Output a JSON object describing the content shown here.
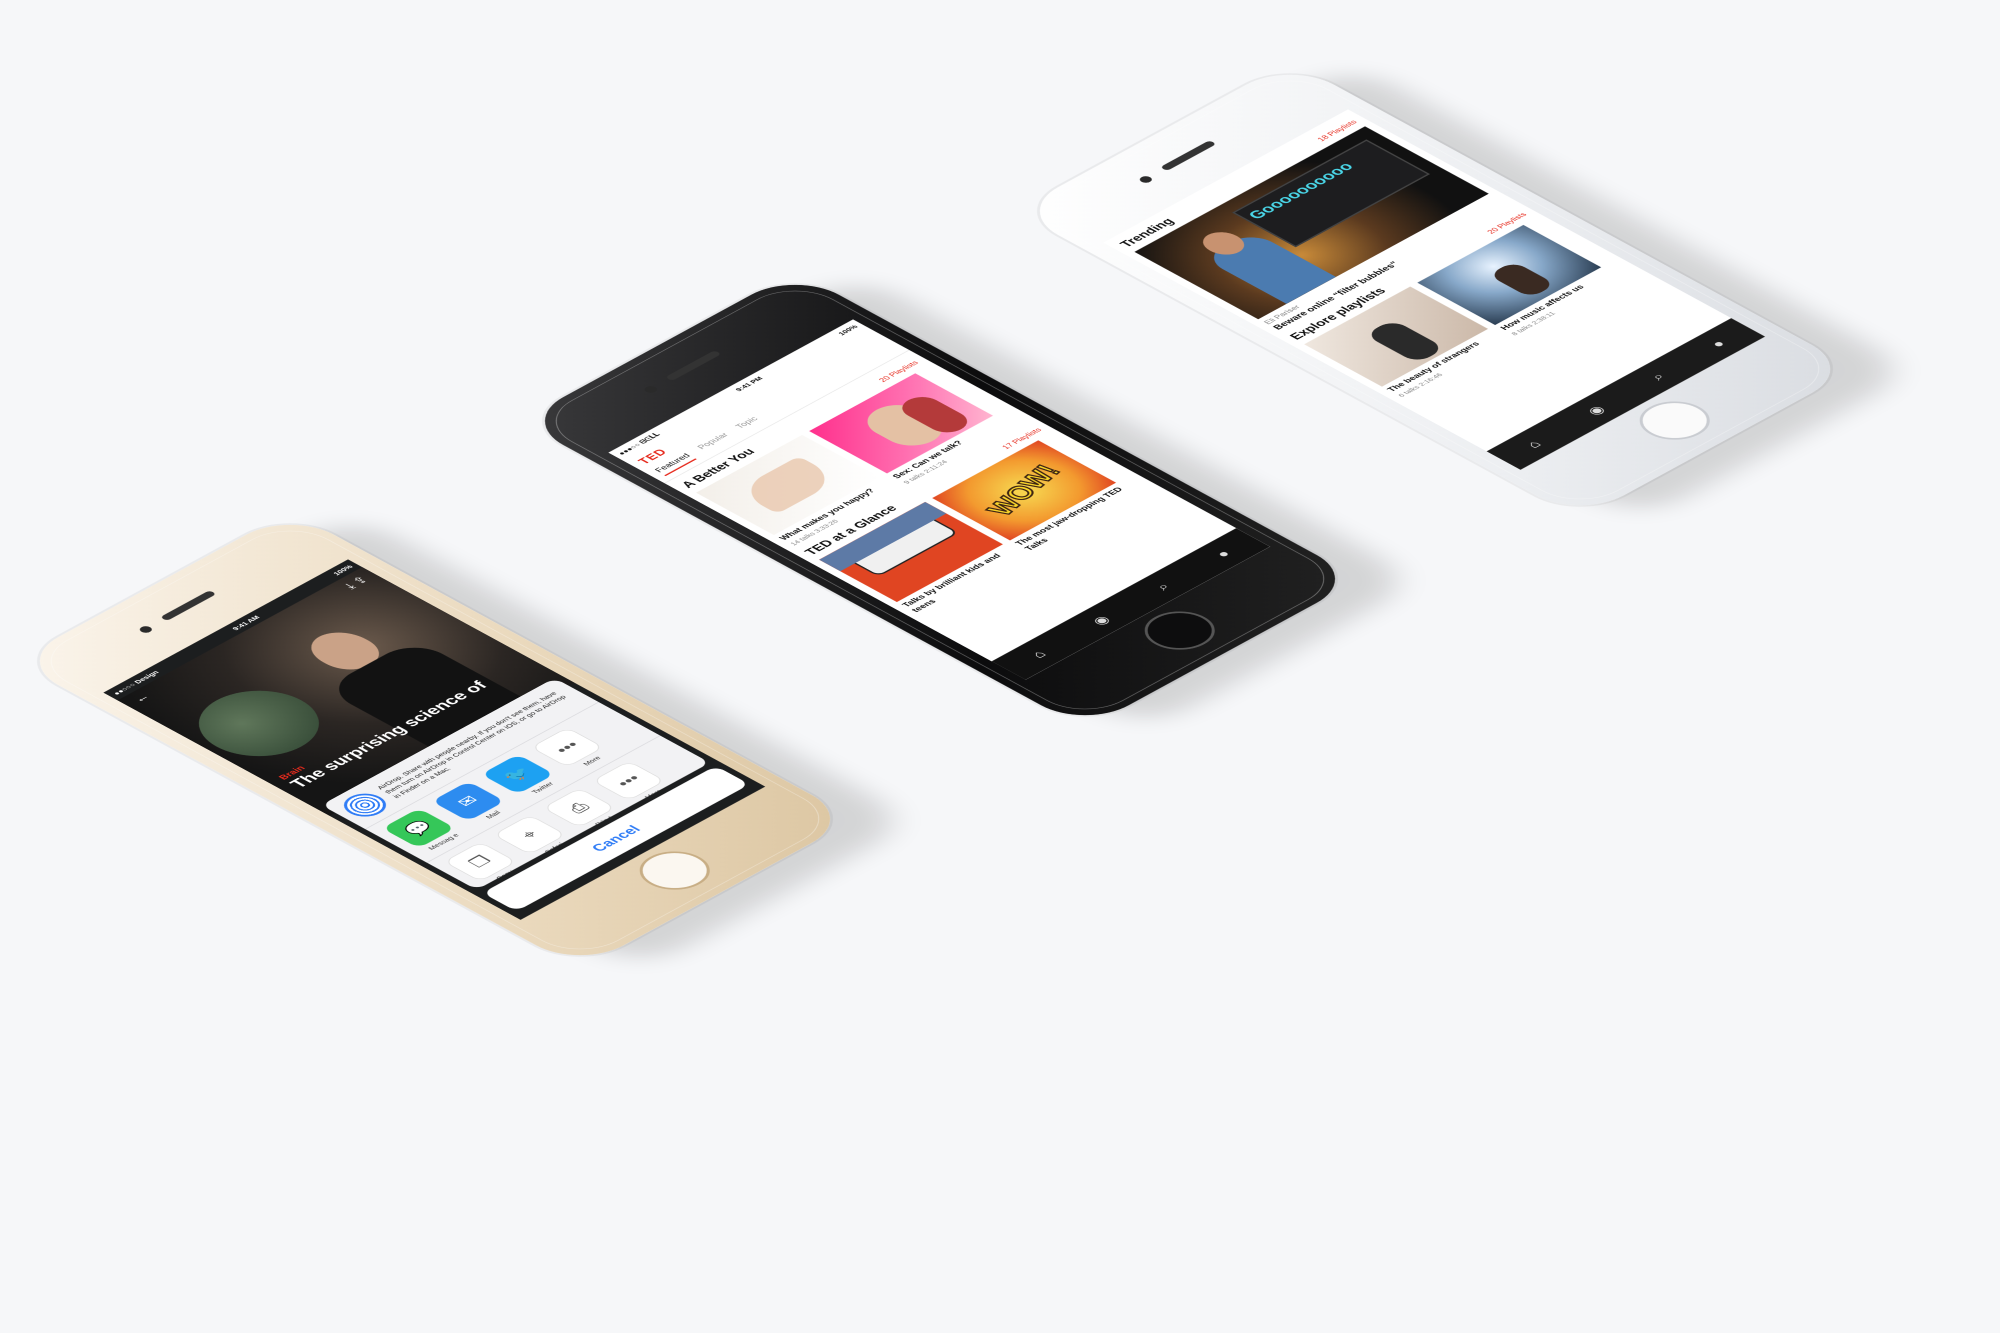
{
  "gold_phone": {
    "status": {
      "carrier": "●●○○○ Design",
      "time": "9:41 AM",
      "battery": "100%"
    },
    "talk": {
      "category": "Brain",
      "title": "The surprising science of"
    },
    "nav": {
      "back": "←",
      "download": "⤓",
      "share": "⇪"
    },
    "share_sheet": {
      "airdrop_text": "AirDrop. Share with people nearby. If you don't see them, have them turn on AirDrop in Control Center on iOS, or go to AirDrop in Finder on a Mac.",
      "apps": [
        {
          "name": "Messag e",
          "icon": "messages-icon"
        },
        {
          "name": "Mail",
          "icon": "mail-icon"
        },
        {
          "name": "Twitter",
          "icon": "twitter-icon"
        },
        {
          "name": "More",
          "icon": "more-icon"
        }
      ],
      "actions": [
        {
          "name": "Copy",
          "icon": "copy-icon"
        },
        {
          "name": "Safari",
          "icon": "safari-icon"
        },
        {
          "name": "Prin t",
          "icon": "print-icon"
        },
        {
          "name": "More",
          "icon": "more-icon"
        }
      ],
      "cancel": "Cancel"
    }
  },
  "space_phone": {
    "status": {
      "carrier": "●●●○○ ᗺᕮᒪᒪ",
      "time": "9:41 PM",
      "battery": "100%"
    },
    "logo": "TED",
    "tabs": [
      "Featured",
      "Popular",
      "Topic"
    ],
    "section1": {
      "title": "A Better You",
      "count": "20 Playlists",
      "cards": [
        {
          "title": "What makes you happy?",
          "meta": "14 talks  3:33:26",
          "thumb": "hands"
        },
        {
          "title": "Sex: Can we talk?",
          "meta": "9 talks  2:11:24",
          "thumb": "couple"
        }
      ]
    },
    "section2": {
      "title": "TED at a Glance",
      "count": "17 Playlists",
      "cards": [
        {
          "title": "Talks by brilliant kids and teens",
          "meta": "",
          "thumb": "shoes"
        },
        {
          "title": "The most jaw-dropping TED Talks",
          "meta": "",
          "thumb": "wow",
          "thumb_text": "WOW!"
        }
      ]
    },
    "tab_icons": [
      "home-icon",
      "record-icon",
      "search-icon",
      "profile-icon"
    ]
  },
  "silver_phone": {
    "trending": {
      "title": "Trending",
      "count": "18 Playlists",
      "screen_text": "Goooooooooo",
      "speaker": "Eli Pariser",
      "talk_title": "Beware online \"filter bubbles\""
    },
    "explore": {
      "title": "Explore playlists",
      "count": "20 Playlists",
      "cards": [
        {
          "title": "The beauty of strangers",
          "meta": "6 talks  2:16:46",
          "thumb": "strangers"
        },
        {
          "title": "How music affects us",
          "meta": "8 talks  2:38:11",
          "thumb": "music"
        }
      ]
    },
    "tab_icons": [
      "home-icon",
      "record-icon",
      "search-icon",
      "profile-icon"
    ]
  }
}
